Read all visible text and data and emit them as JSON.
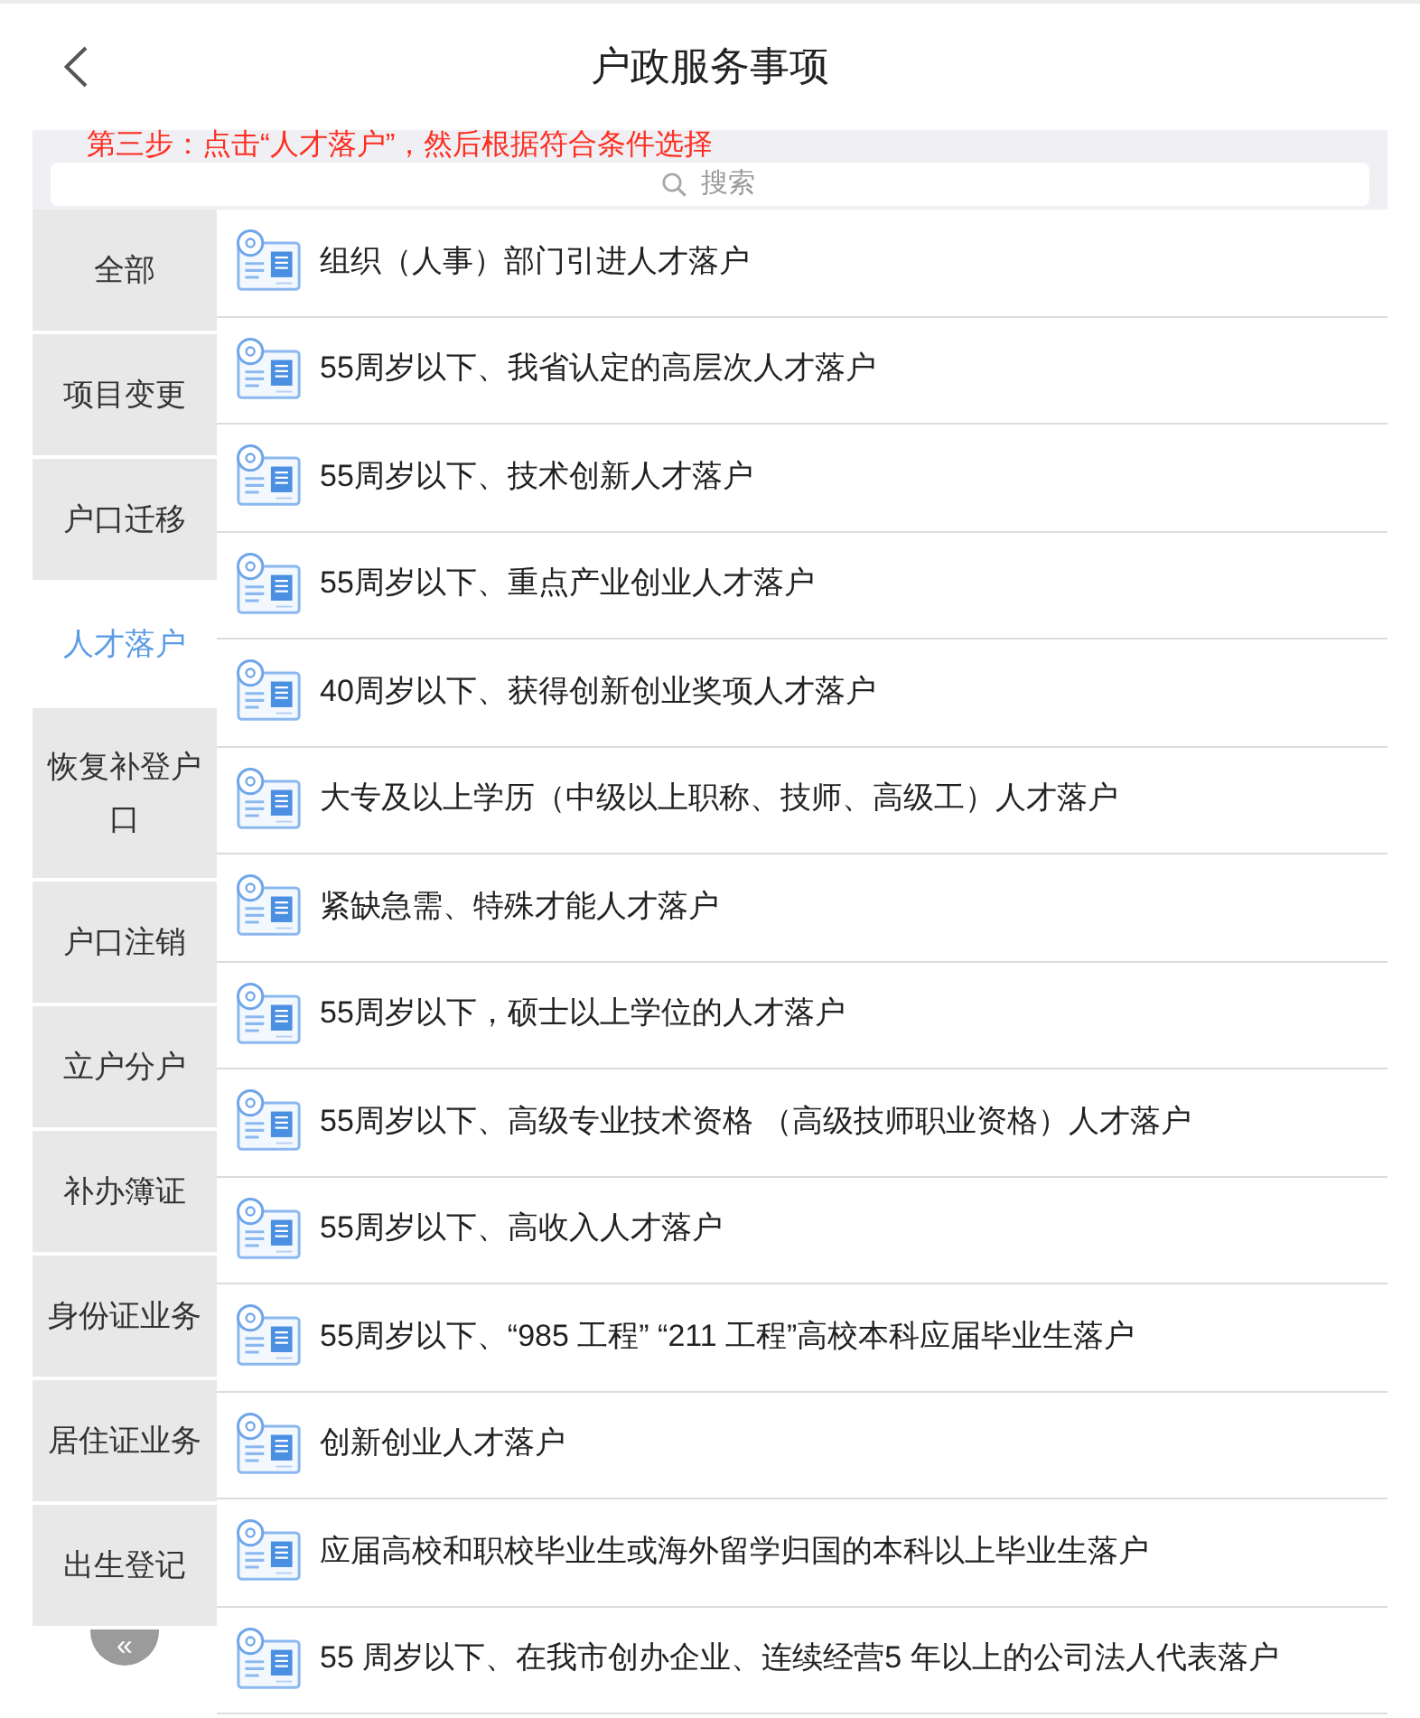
{
  "header": {
    "title": "户政服务事项"
  },
  "search": {
    "placeholder": "搜索"
  },
  "instruction": "第三步：点击“人才落户”，然后根据符合条件选择",
  "categories": [
    {
      "label": "全部",
      "selected": false
    },
    {
      "label": "项目变更",
      "selected": false
    },
    {
      "label": "户口迁移",
      "selected": false
    },
    {
      "label": "人才落户",
      "selected": true
    },
    {
      "label": "恢复补登户口",
      "selected": false
    },
    {
      "label": "户口注销",
      "selected": false
    },
    {
      "label": "立户分户",
      "selected": false
    },
    {
      "label": "补办簿证",
      "selected": false
    },
    {
      "label": "身份证业务",
      "selected": false
    },
    {
      "label": "居住证业务",
      "selected": false
    },
    {
      "label": "出生登记",
      "selected": false
    }
  ],
  "collapse_button": {
    "label": "«"
  },
  "items": [
    {
      "label": "组织（人事）部门引进人才落户"
    },
    {
      "label": "55周岁以下、我省认定的高层次人才落户"
    },
    {
      "label": "55周岁以下、技术创新人才落户"
    },
    {
      "label": "55周岁以下、重点产业创业人才落户"
    },
    {
      "label": "40周岁以下、获得创新创业奖项人才落户"
    },
    {
      "label": "大专及以上学历（中级以上职称、技师、高级工）人才落户"
    },
    {
      "label": "紧缺急需、特殊才能人才落户"
    },
    {
      "label": "55周岁以下，硕士以上学位的人才落户"
    },
    {
      "label": "55周岁以下、高级专业技术资格 （高级技师职业资格）人才落户"
    },
    {
      "label": "55周岁以下、高收入人才落户"
    },
    {
      "label": "55周岁以下、“985 工程” “211 工程”高校本科应届毕业生落户"
    },
    {
      "label": "创新创业人才落户"
    },
    {
      "label": "应届高校和职校毕业生或海外留学归国的本科以上毕业生落户"
    },
    {
      "label": "55 周岁以下、在我市创办企业、连续经营5 年以上的公司法人代表落户"
    }
  ]
}
